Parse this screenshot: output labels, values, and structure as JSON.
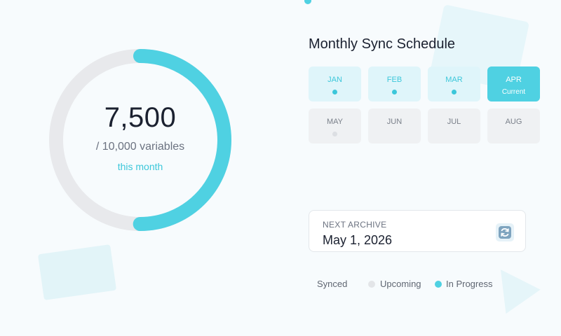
{
  "usage": {
    "value": "7,500",
    "total_label": "/ 10,000 variables",
    "period_label": "this month",
    "used": 7500,
    "limit": 10000
  },
  "schedule": {
    "title": "Monthly Sync Schedule",
    "months": [
      {
        "label": "JAN",
        "status": "synced"
      },
      {
        "label": "FEB",
        "status": "synced"
      },
      {
        "label": "MAR",
        "status": "synced"
      },
      {
        "label": "APR",
        "status": "current",
        "sublabel": "Current"
      },
      {
        "label": "MAY",
        "status": "upcoming"
      },
      {
        "label": "JUN",
        "status": "idle"
      },
      {
        "label": "JUL",
        "status": "idle"
      },
      {
        "label": "AUG",
        "status": "idle"
      }
    ]
  },
  "archive": {
    "label": "NEXT ARCHIVE",
    "date": "May 1, 2026",
    "refresh_icon": "refresh-icon"
  },
  "legend": {
    "synced": "Synced",
    "upcoming": "Upcoming",
    "in_progress": "In Progress"
  },
  "colors": {
    "accent": "#4fd1e2",
    "accent_text": "#3cc7da",
    "track": "#e8e9ec",
    "synced_bg": "#dff5fa",
    "idle_bg": "#eff1f3"
  }
}
